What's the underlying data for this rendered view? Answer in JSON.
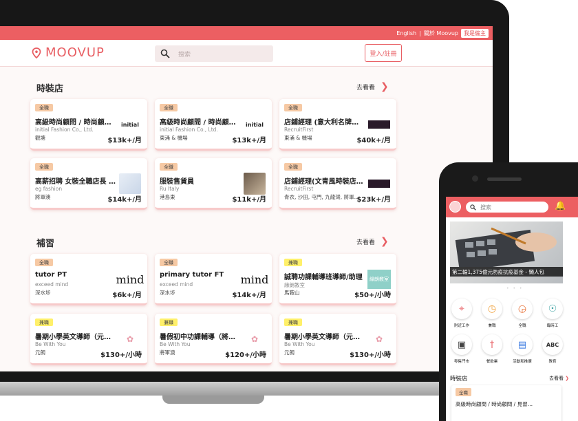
{
  "topbar": {
    "lang": "English",
    "about": "關於 Moovup",
    "employer": "我是僱主"
  },
  "header": {
    "logo": "MOOVUP",
    "search_placeholder": "搜索",
    "login": "登入/註冊"
  },
  "sections": [
    {
      "title": "時裝店",
      "see_all": "去看看",
      "jobs": [
        {
          "type": "全職",
          "title": "高級時尚顧問 / 時尚顧問…",
          "company": "initial Fashion Co., Ltd.",
          "location": "觀塘",
          "salary": "$13k+/月",
          "logo": "initial"
        },
        {
          "type": "全職",
          "title": "高級時尚顧問 / 時尚顧問…",
          "company": "initial Fashion Co., Ltd.",
          "location": "東涌 & 機場",
          "salary": "$13k+/月",
          "logo": "initial"
        },
        {
          "type": "全職",
          "title": "店鋪經理 (意大利名牌時…",
          "company": "RecruitFirst",
          "location": "東涌 & 機場",
          "salary": "$40k+/月",
          "logo": ""
        },
        {
          "type": "全職",
          "title": "高薪招聘 女裝全職店長 (…",
          "company": "eg fashion",
          "location": "將軍澳",
          "salary": "$14k+/月",
          "logo": ""
        },
        {
          "type": "全職",
          "title": "服裝售貨員",
          "company": "Ru Italy",
          "location": "港島東",
          "salary": "$11k+/月",
          "logo": ""
        },
        {
          "type": "全職",
          "title": "店鋪經理(文青風時裝店)…",
          "company": "RecruitFirst",
          "location": "青衣, 沙田, 屯門, 九龍灣, 將軍…",
          "salary": "$23k+/月",
          "logo": ""
        }
      ]
    },
    {
      "title": "補習",
      "see_all": "去看看",
      "jobs": [
        {
          "type": "全職",
          "title": "tutor PT",
          "company": "exceed mind",
          "location": "深水埗",
          "salary": "$6k+/月",
          "logo": "mind"
        },
        {
          "type": "全職",
          "title": "primary tutor FT",
          "company": "exceed mind",
          "location": "深水埗",
          "salary": "$14k+/月",
          "logo": "mind"
        },
        {
          "type": "兼職",
          "title": "誠聘功課輔導班導師/助理",
          "company": "緣朗教室",
          "location": "馬鞍山",
          "salary": "$50+/小時",
          "logo": "緣朗教室"
        },
        {
          "type": "兼職",
          "title": "暑期小學英文導師（元朗…",
          "company": "Be With You",
          "location": "元朗",
          "salary": "$130+/小時",
          "logo": ""
        },
        {
          "type": "兼職",
          "title": "暑假初中功課輔導（將軍…",
          "company": "Be With You",
          "location": "將軍澳",
          "salary": "$120+/小時",
          "logo": ""
        },
        {
          "type": "兼職",
          "title": "暑期小學英文導師（元朗…",
          "company": "Be With You",
          "location": "元朗",
          "salary": "$130+/小時",
          "logo": ""
        }
      ]
    }
  ],
  "phone": {
    "search_placeholder": "搜索",
    "banner_caption": "第二輪1,375億元防疫抗疫基金 - 懶人包",
    "categories": [
      {
        "label": "附近工作",
        "icon": "map-pin-icon"
      },
      {
        "label": "兼職",
        "icon": "clock-icon"
      },
      {
        "label": "全職",
        "icon": "clock-icon"
      },
      {
        "label": "臨時工",
        "icon": "compass-icon"
      },
      {
        "label": "零售門市",
        "icon": "shopping-bag-icon"
      },
      {
        "label": "餐飲業",
        "icon": "cutlery-icon"
      },
      {
        "label": "活動和推廣",
        "icon": "promotion-icon"
      },
      {
        "label": "教育",
        "icon": "abc-blocks-icon"
      }
    ],
    "section_title": "時裝店",
    "see_all": "去看看",
    "card": {
      "type": "全職",
      "title": "高級時尚顧問 / 時尚顧問 / 見習…"
    }
  },
  "colors": {
    "brand": "#ec5f62",
    "full_time": "#f6c9a4",
    "part_time": "#fff06a"
  }
}
